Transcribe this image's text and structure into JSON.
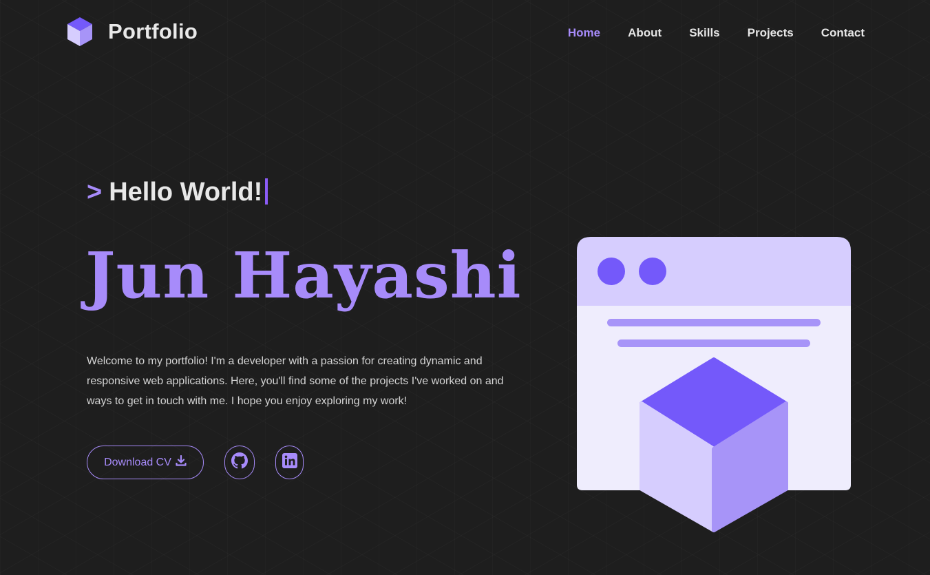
{
  "brand": {
    "name": "Portfolio",
    "logo_icon": "cube-icon",
    "accent": "#a78bfa"
  },
  "nav": {
    "items": [
      {
        "label": "Home",
        "active": true
      },
      {
        "label": "About",
        "active": false
      },
      {
        "label": "Skills",
        "active": false
      },
      {
        "label": "Projects",
        "active": false
      },
      {
        "label": "Contact",
        "active": false
      }
    ]
  },
  "hero": {
    "prompt": ">",
    "greeting": "Hello World!",
    "name": "Jun Hayashi",
    "intro": "Welcome to my portfolio! I'm a developer with a passion for creating dynamic and responsive web applications. Here, you'll find some of the projects I've worked on and ways to get in touch with me. I hope you enjoy exploring my work!",
    "cv_button": "Download CV",
    "cv_icon": "download-icon",
    "social": [
      {
        "icon": "github-icon"
      },
      {
        "icon": "linkedin-icon"
      }
    ]
  },
  "illustration": {
    "icon": "browser-window-cube-illustration",
    "colors": {
      "window": "#efedfd",
      "titlebar": "#d6cdfe",
      "dots": "#7459fa",
      "lines": "#a794f8",
      "cube_top": "#7459fa",
      "cube_left": "#d6cdfe",
      "cube_right": "#a794f8"
    }
  }
}
